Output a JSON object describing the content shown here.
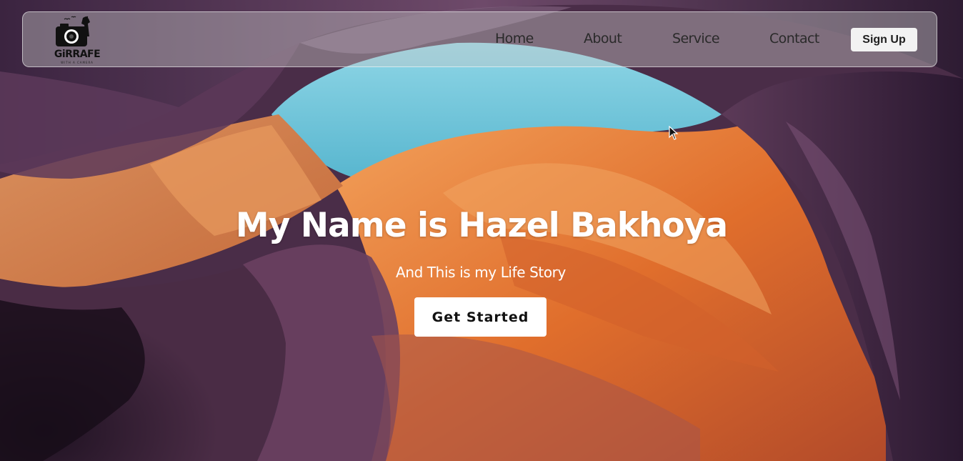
{
  "nav": {
    "logo_text": "GiRRAFE",
    "logo_subtext": "WITH A CAMERA",
    "links": [
      {
        "label": "Home"
      },
      {
        "label": "About"
      },
      {
        "label": "Service"
      },
      {
        "label": "Contact"
      }
    ],
    "signup_label": "Sign Up"
  },
  "hero": {
    "title": "My Name is Hazel Bakhoya",
    "subtitle": "And This is my Life Story",
    "cta_label": "Get Started",
    "background_image": "canyon-arch-background"
  },
  "colors": {
    "sky": "#6ec3d6",
    "rock_orange": "#e0722d",
    "rock_purple": "#5a3552",
    "text_white": "#ffffff",
    "nav_text": "#2a2a2a"
  }
}
